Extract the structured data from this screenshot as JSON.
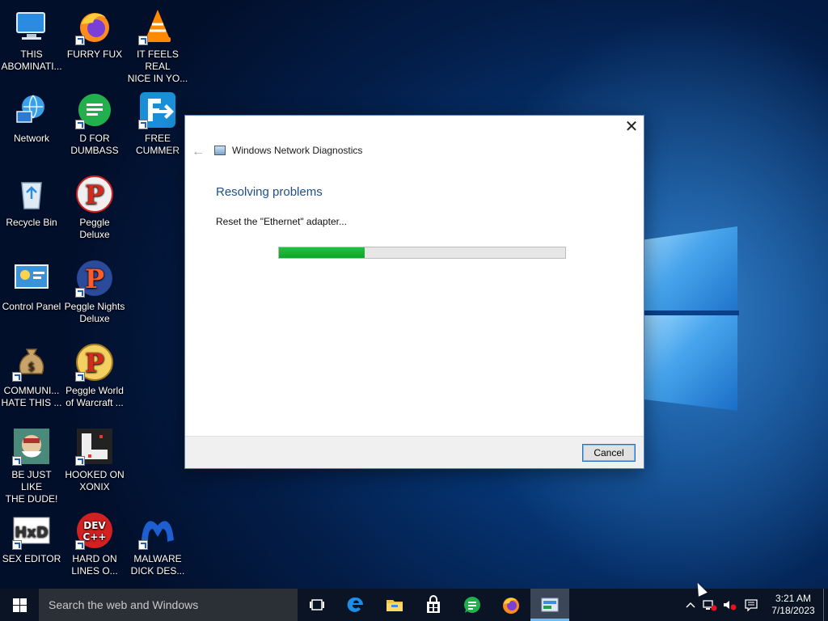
{
  "desktop": {
    "icons": [
      {
        "label": "THIS\nABOMINATI...",
        "icon": "computer-icon"
      },
      {
        "label": "FURRY FUX",
        "icon": "firefox-icon"
      },
      {
        "label": "IT FEELS REAL\nNICE IN YO...",
        "icon": "vlc-icon"
      },
      {
        "label": "Network",
        "icon": "network-icon"
      },
      {
        "label": "D FOR\nDUMBASS",
        "icon": "chat-app-icon"
      },
      {
        "label": "FREE\nCUMMER",
        "icon": "converter-icon"
      },
      {
        "label": "Recycle Bin",
        "icon": "recycle-bin-icon"
      },
      {
        "label": "Peggle Deluxe",
        "icon": "peggle-icon"
      },
      {
        "label": "Control Panel",
        "icon": "control-panel-icon"
      },
      {
        "label": "Peggle Nights\nDeluxe",
        "icon": "peggle-nights-icon"
      },
      {
        "label": "COMMUNI...\nHATE THIS ...",
        "icon": "money-bag-icon"
      },
      {
        "label": "Peggle World\nof Warcraft ...",
        "icon": "peggle-wow-icon"
      },
      {
        "label": "BE JUST LIKE\nTHE DUDE!",
        "icon": "game-character-icon"
      },
      {
        "label": "HOOKED ON\nXONIX",
        "icon": "xonix-icon"
      },
      {
        "label": "SEX EDITOR",
        "icon": "hex-editor-icon"
      },
      {
        "label": "HARD ON\nLINES O...",
        "icon": "dev-cpp-icon"
      },
      {
        "label": "MALWARE\nDICK DES...",
        "icon": "malwarebytes-icon"
      }
    ]
  },
  "dialog": {
    "app_title": "Windows Network Diagnostics",
    "heading": "Resolving problems",
    "status": "Reset the \"Ethernet\" adapter...",
    "progress_fraction": 0.3,
    "cancel_label": "Cancel",
    "close_glyph": "✕",
    "back_glyph": "←"
  },
  "taskbar": {
    "search_placeholder": "Search the web and Windows",
    "apps": [
      "task-view-icon",
      "edge-icon",
      "file-explorer-icon",
      "store-icon",
      "chat-app-icon",
      "firefox-icon",
      "network-diagnostics-icon"
    ],
    "time": "3:21 AM",
    "date": "7/18/2023"
  },
  "colors": {
    "accent": "#1f4e8c",
    "progress": "#0da62a",
    "taskbar": "#0b1424"
  }
}
